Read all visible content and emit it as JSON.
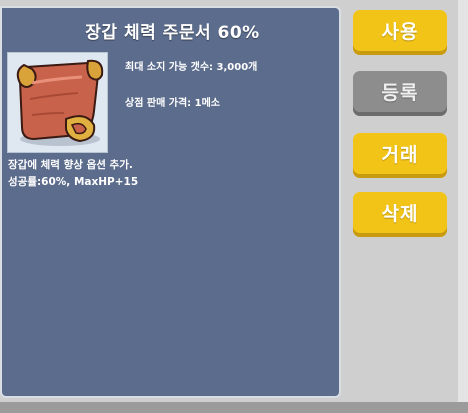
{
  "item": {
    "name": "장갑 체력 주문서 60%",
    "max_hold": "최대 소지 가능 갯수: 3,000개",
    "sell_price": "상점 판매 가격: 1메소",
    "description_line1": "장갑에 체력 향상 옵션 추가.",
    "description_line2": "성공률:60%, MaxHP+15",
    "icon": "scroll-icon"
  },
  "actions": {
    "use": "사용",
    "register": "등록",
    "trade": "거래",
    "delete": "삭제"
  },
  "colors": {
    "panel": "#5c6c8c",
    "button_active": "#f2c418",
    "button_disabled": "#8d8d8d"
  }
}
